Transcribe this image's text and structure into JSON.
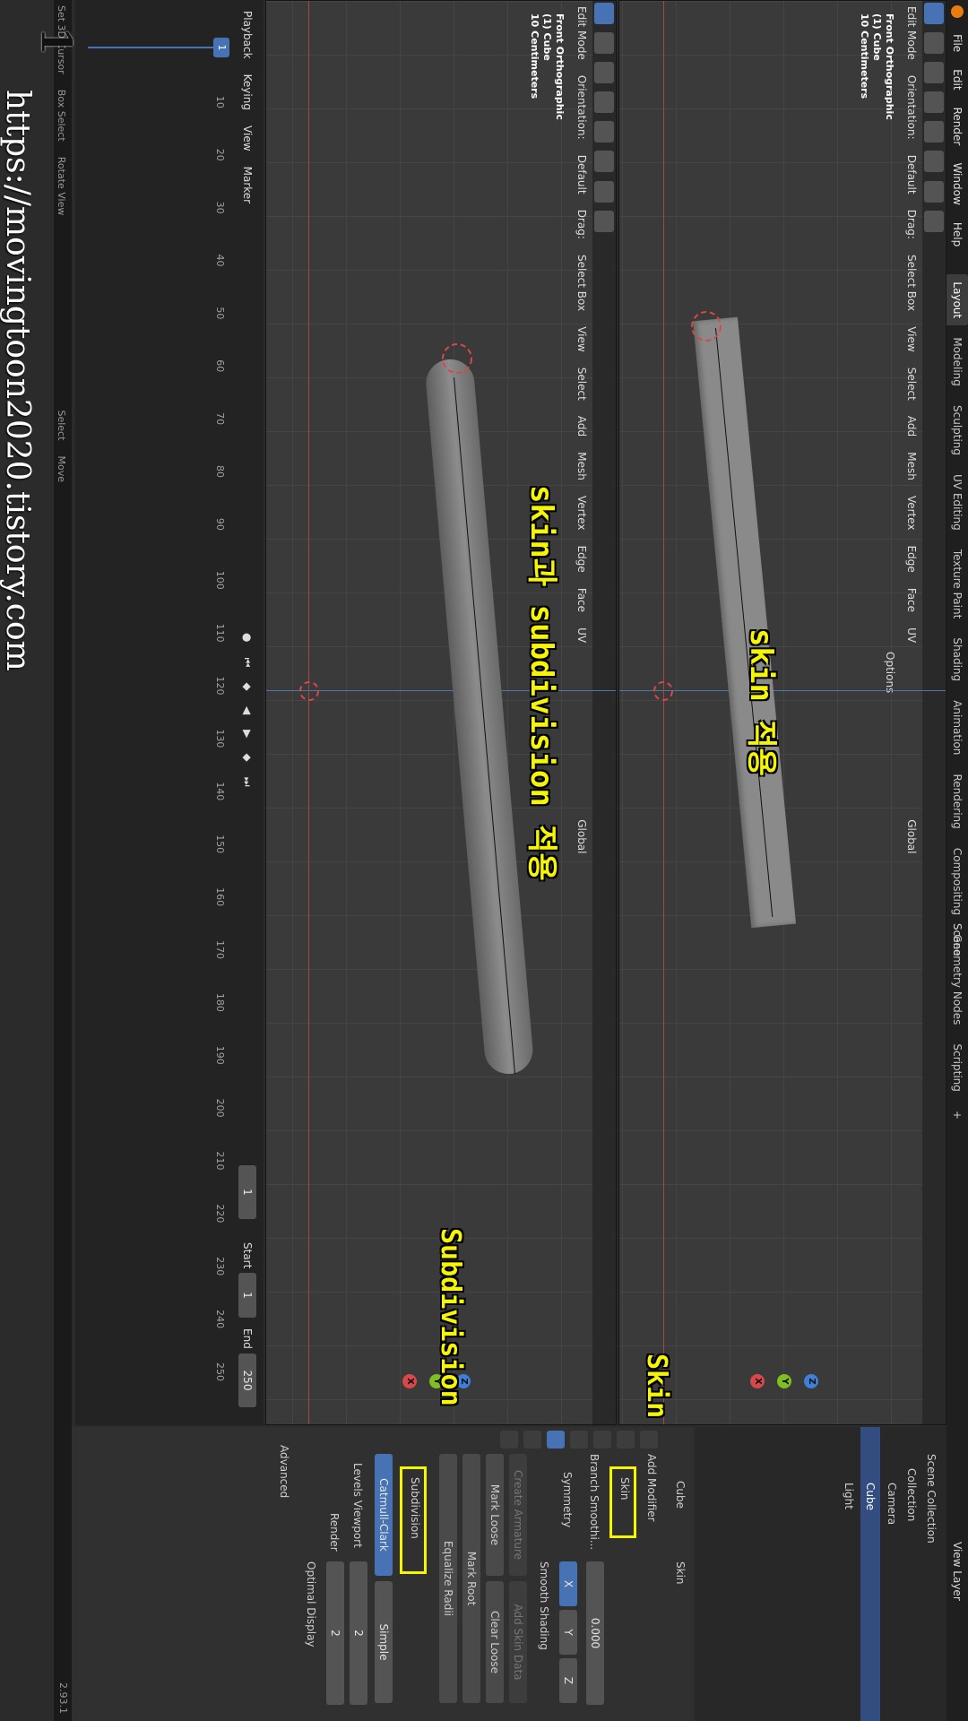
{
  "app": {
    "title": "Blender",
    "version": "2.93.1"
  },
  "menu": [
    "File",
    "Edit",
    "Render",
    "Window",
    "Help"
  ],
  "workspaces": [
    "Layout",
    "Modeling",
    "Sculpting",
    "UV Editing",
    "Texture Paint",
    "Shading",
    "Animation",
    "Rendering",
    "Compositing",
    "Geometry Nodes",
    "Scripting",
    "+"
  ],
  "viewport_header": {
    "mode": "Edit Mode",
    "orientation_label": "Orientation:",
    "orientation_value": "Default",
    "drag_label": "Drag:",
    "drag_value": "Select Box",
    "menus": [
      "View",
      "Select",
      "Add",
      "Mesh",
      "Vertex",
      "Edge",
      "Face",
      "UV"
    ],
    "transform": "Global",
    "options": "Options"
  },
  "viewport_top": {
    "info": [
      "Front Orthographic",
      "(1) Cube",
      "10 Centimeters"
    ],
    "annotation": "skin 적용"
  },
  "viewport_bottom": {
    "info": [
      "Front Orthographic",
      "(1) Cube",
      "10 Centimeters"
    ],
    "annotation": "skin과 subdivision 적용"
  },
  "gizmo": {
    "x": "X",
    "y": "Y",
    "z": "Z"
  },
  "timeline": {
    "menus": [
      "Playback",
      "Keying",
      "View",
      "Marker"
    ],
    "current_frame": "1",
    "start_label": "Start",
    "start_value": "1",
    "end_label": "End",
    "end_value": "250",
    "frame_badge": "1",
    "ticks": [
      "1",
      "10",
      "20",
      "30",
      "40",
      "50",
      "60",
      "70",
      "80",
      "90",
      "100",
      "110",
      "120",
      "130",
      "140",
      "150",
      "160",
      "170",
      "180",
      "190",
      "200",
      "210",
      "220",
      "230",
      "240",
      "250"
    ]
  },
  "overlay_number": "1",
  "outliner": {
    "scene": "Scene",
    "view_layer": "View Layer",
    "items": [
      "Scene Collection",
      "Collection",
      "Camera",
      "Cube",
      "Light"
    ]
  },
  "properties": {
    "object": "Cube",
    "modifier_object": "Skin",
    "add_modifier": "Add Modifier",
    "skin": {
      "name": "Skin",
      "branch_smoothing_label": "Branch Smoothi...",
      "branch_smoothing_value": "0.000",
      "symmetry_label": "Symmetry",
      "axes": [
        "X",
        "Y",
        "Z"
      ],
      "smooth_shading": "Smooth Shading",
      "create_armature": "Create Armature",
      "add_skin_data": "Add Skin Data",
      "mark_loose": "Mark Loose",
      "clear_loose": "Clear Loose",
      "mark_root": "Mark Root",
      "equalize_radii": "Equalize Radii"
    },
    "subdivision": {
      "name": "Subdivision",
      "type_active": "Catmull-Clark",
      "type_other": "Simple",
      "levels_viewport_label": "Levels Viewport",
      "levels_viewport_value": "2",
      "render_label": "Render",
      "render_value": "2",
      "optimal_display": "Optimal Display",
      "advanced": "Advanced"
    }
  },
  "annotations": {
    "skin": "Skin",
    "subdivision": "Subdivision"
  },
  "statusbar": [
    "Set 3D Cursor",
    "Box Select",
    "Rotate View",
    "Select",
    "Move"
  ],
  "watermark": "https://movingtoon2020.tistory.com",
  "colors": {
    "accent": "#4772b3",
    "annotation": "#f5f500",
    "x_axis": "#d94848",
    "y_axis": "#7fbf1f",
    "z_axis": "#3f7fd8"
  }
}
